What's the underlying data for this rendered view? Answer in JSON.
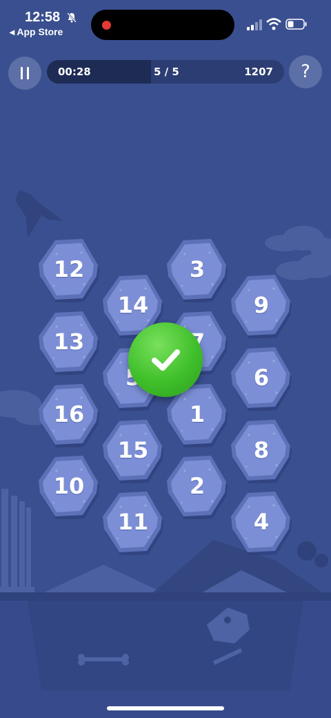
{
  "status_bar": {
    "time": "12:58",
    "back_label": "◂ App Store",
    "icons": [
      "bell-slash-icon",
      "signal-icon",
      "wifi-icon",
      "battery-icon"
    ]
  },
  "hud": {
    "timer": "00:28",
    "level": "5 / 5",
    "score": "1207",
    "progress_fraction": 0.44
  },
  "buttons": {
    "pause_icon": "pause-icon",
    "help_label": "?"
  },
  "tiles": [
    {
      "id": "t12",
      "label": "12"
    },
    {
      "id": "t3",
      "label": "3"
    },
    {
      "id": "t14",
      "label": "14"
    },
    {
      "id": "t9",
      "label": "9"
    },
    {
      "id": "t13",
      "label": "13"
    },
    {
      "id": "t7",
      "label": "7"
    },
    {
      "id": "t5",
      "label": "5"
    },
    {
      "id": "t6",
      "label": "6"
    },
    {
      "id": "t16",
      "label": "16"
    },
    {
      "id": "t1",
      "label": "1"
    },
    {
      "id": "t15",
      "label": "15"
    },
    {
      "id": "t8",
      "label": "8"
    },
    {
      "id": "t10",
      "label": "10"
    },
    {
      "id": "t2",
      "label": "2"
    },
    {
      "id": "t11",
      "label": "11"
    },
    {
      "id": "t4",
      "label": "4"
    }
  ],
  "result": {
    "icon": "checkmark-icon",
    "color": "#3fbf2a"
  },
  "colors": {
    "background": "#3a4f8f",
    "tile_fill": "#7c8fd6",
    "tile_shadow": "#2e3f7a"
  }
}
